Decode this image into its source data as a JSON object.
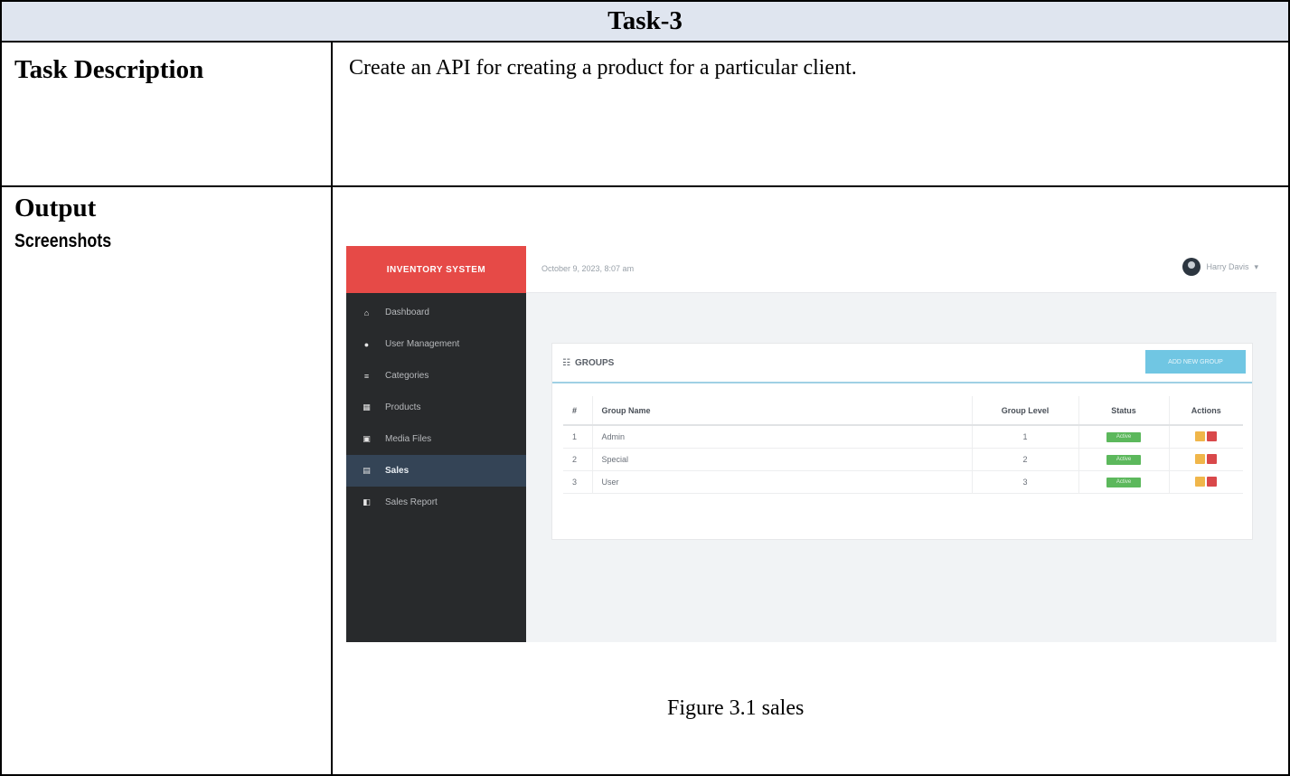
{
  "header": {
    "title": "Task-3"
  },
  "rows": {
    "description_label": "Task Description",
    "description_text": "Create an API for creating a product for a particular client.",
    "output_label": "Output",
    "output_sublabel": "Screenshots"
  },
  "figure": {
    "caption": "Figure 3.1 sales"
  },
  "screenshot": {
    "brand": "INVENTORY SYSTEM",
    "datetime": "October 9, 2023, 8:07 am",
    "user_name": "Harry Davis",
    "nav": [
      {
        "label": "Dashboard",
        "icon": "home-icon"
      },
      {
        "label": "User Management",
        "icon": "user-icon"
      },
      {
        "label": "Categories",
        "icon": "list-icon"
      },
      {
        "label": "Products",
        "icon": "grid-icon"
      },
      {
        "label": "Media Files",
        "icon": "image-icon"
      },
      {
        "label": "Sales",
        "icon": "credit-card-icon",
        "active": true
      },
      {
        "label": "Sales Report",
        "icon": "chart-icon"
      }
    ],
    "panel": {
      "title": "GROUPS",
      "add_button": "ADD NEW GROUP",
      "columns": [
        "#",
        "Group Name",
        "Group Level",
        "Status",
        "Actions"
      ],
      "rows": [
        {
          "num": "1",
          "name": "Admin",
          "level": "1",
          "status": "Active"
        },
        {
          "num": "2",
          "name": "Special",
          "level": "2",
          "status": "Active"
        },
        {
          "num": "3",
          "name": "User",
          "level": "3",
          "status": "Active"
        }
      ]
    },
    "colors": {
      "brand_bg": "#e64a47",
      "sidebar_bg": "#282a2c",
      "active_nav_bg": "#344456",
      "status_green": "#5cb85c",
      "add_button_blue": "#70c6e3"
    }
  }
}
